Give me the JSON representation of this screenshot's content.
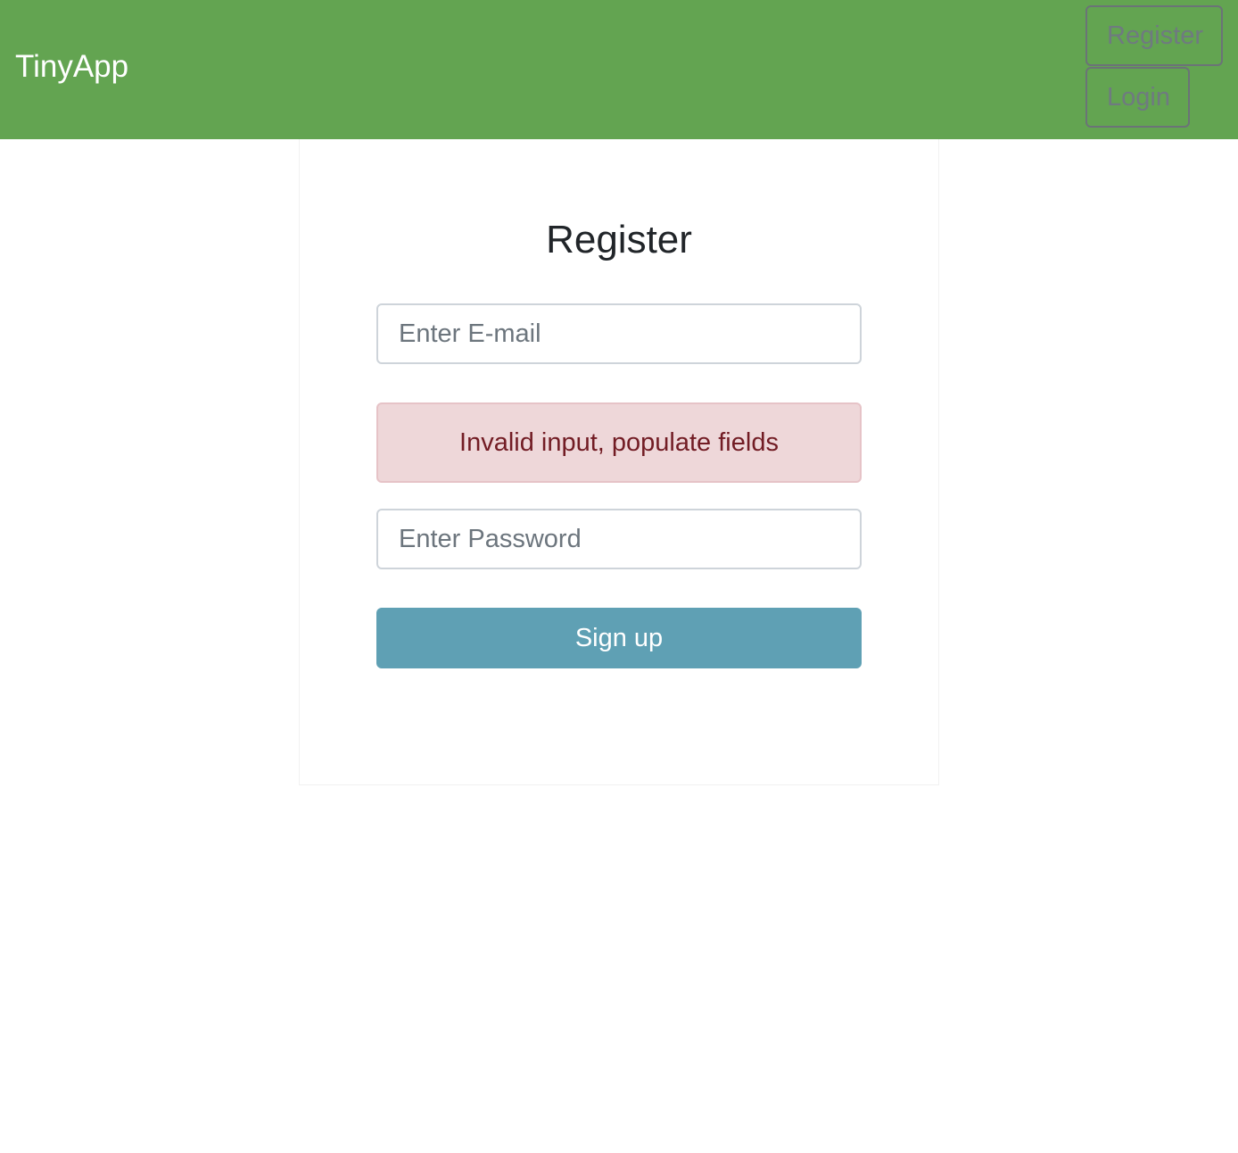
{
  "navbar": {
    "brand": "TinyApp",
    "register_label": "Register",
    "login_label": "Login",
    "background_color": "#63a451"
  },
  "form": {
    "title": "Register",
    "email_placeholder": "Enter E-mail",
    "email_value": "",
    "alert_text": "Invalid input, populate fields",
    "password_placeholder": "Enter Password",
    "password_value": "",
    "submit_label": "Sign up",
    "submit_color": "#5fa0b4",
    "alert_color": "#eed7d9"
  }
}
